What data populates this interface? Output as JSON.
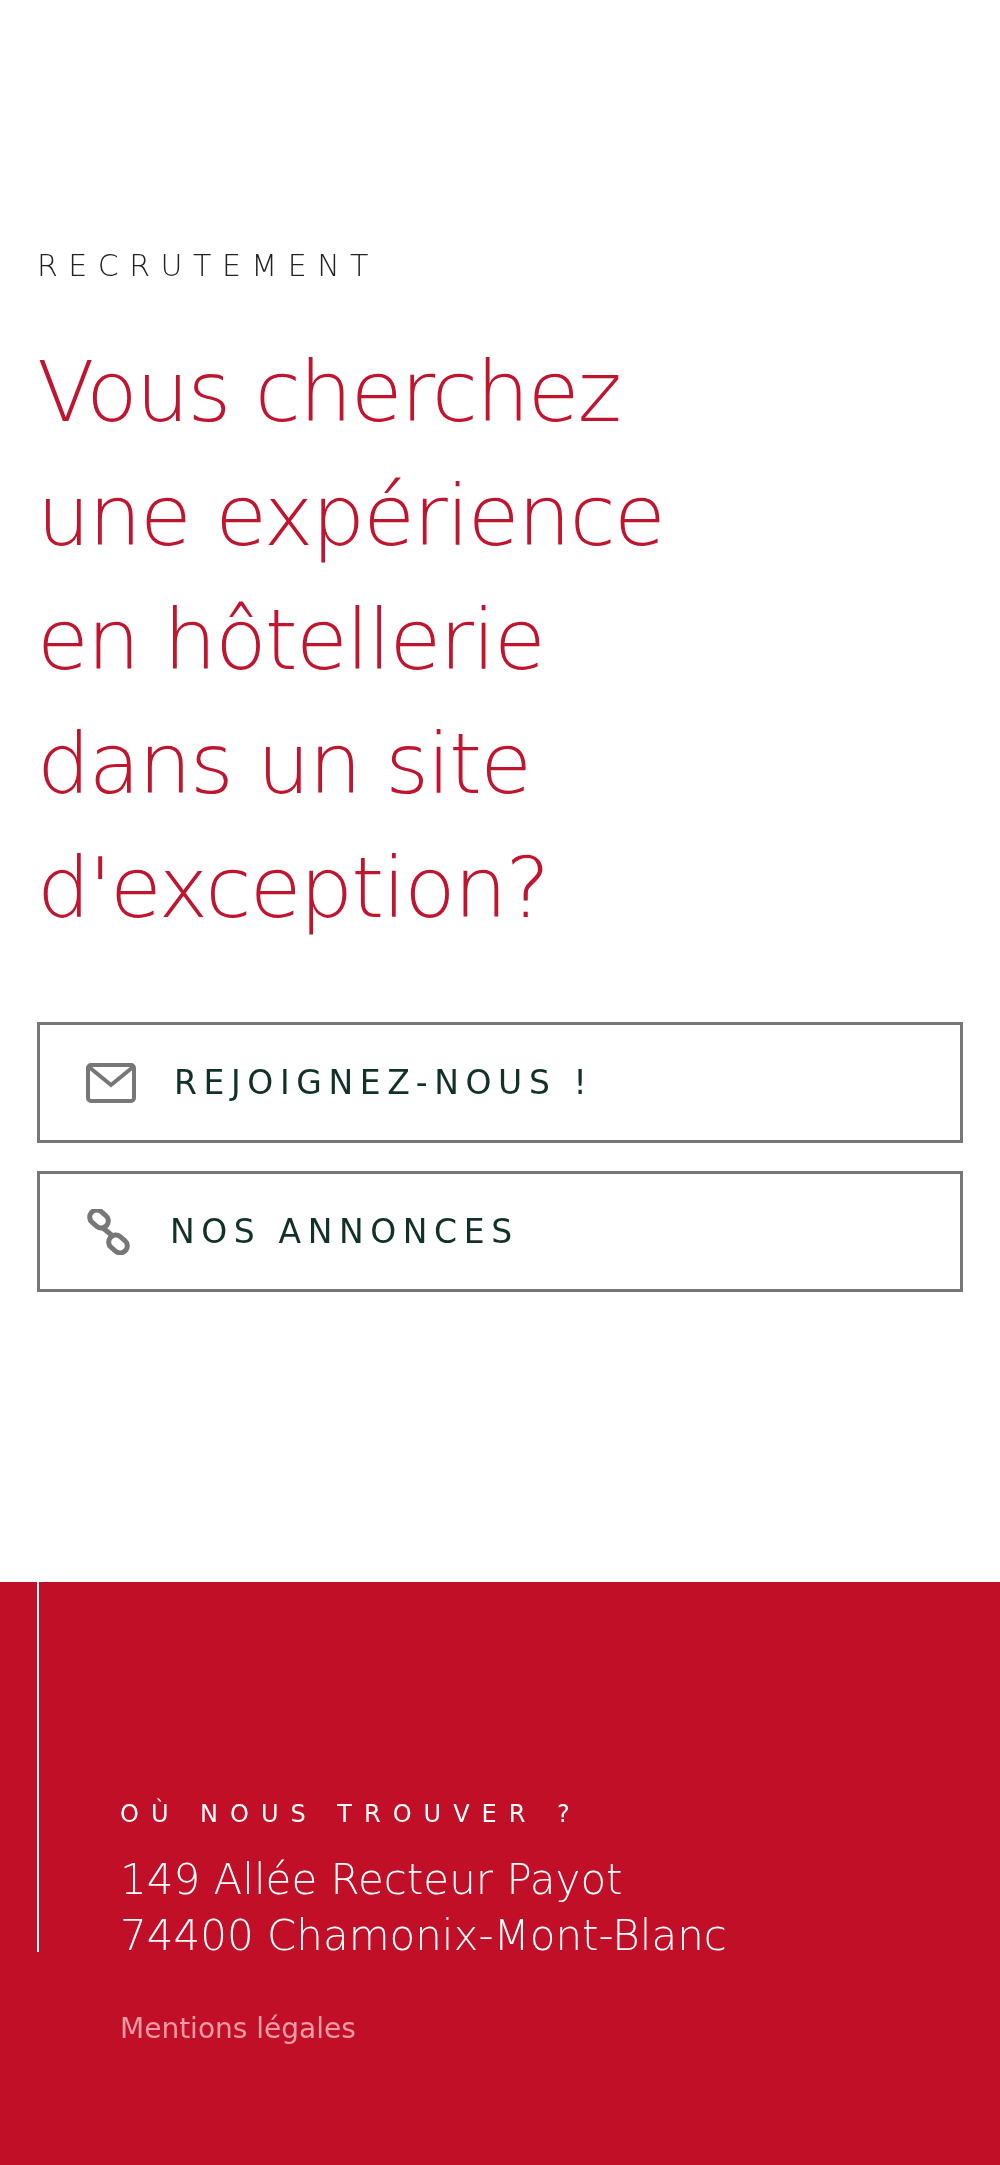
{
  "eyebrow": "RECRUTEMENT",
  "heading_lines": [
    "Vous cherchez",
    "une expérience",
    "en hôtellerie",
    "dans un site",
    "d'exception?"
  ],
  "buttons": [
    {
      "kind": "mail",
      "label": "REJOIGNEZ-NOUS !"
    },
    {
      "kind": "link",
      "label": "NOS ANNONCES"
    }
  ],
  "footer": {
    "title": "OÙ NOUS TROUVER ?",
    "address_lines": [
      "149 Allée Recteur Payot",
      "74400 Chamonix-Mont-Blanc"
    ],
    "legal_link": "Mentions légales"
  }
}
